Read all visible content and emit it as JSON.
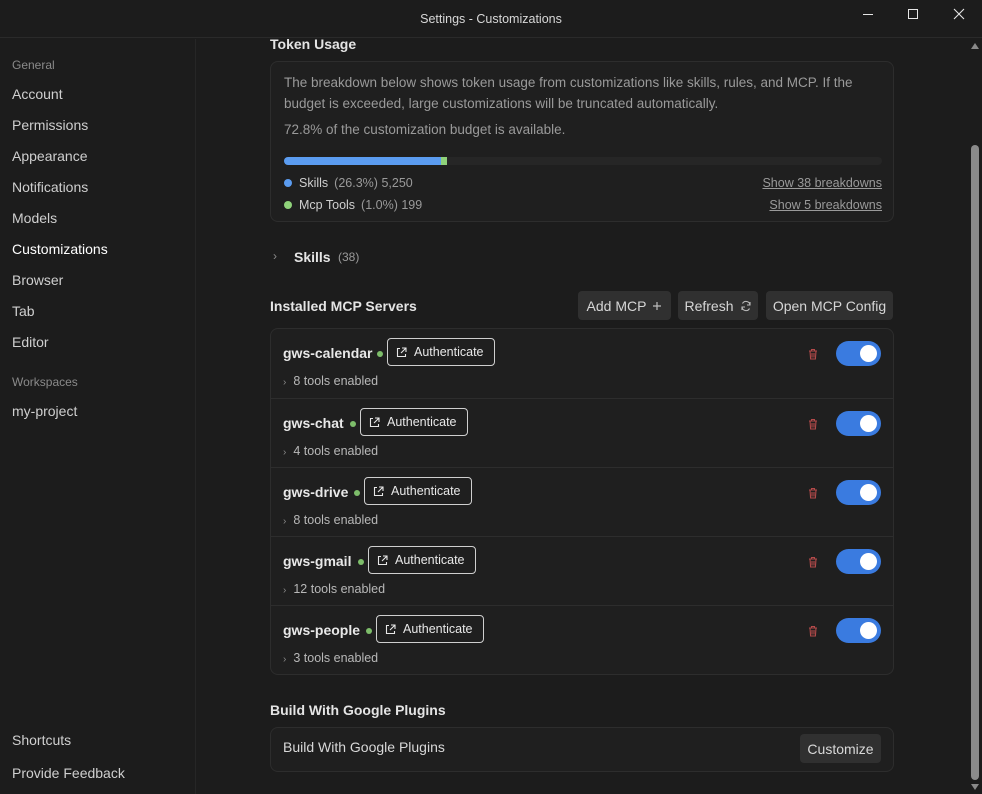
{
  "window": {
    "title": "Settings - Customizations",
    "minimize_icon": "minimize-icon",
    "maximize_icon": "maximize-icon",
    "close_icon": "close-icon"
  },
  "sidebar": {
    "general_heading": "General",
    "items": [
      {
        "label": "Account"
      },
      {
        "label": "Permissions"
      },
      {
        "label": "Appearance"
      },
      {
        "label": "Notifications"
      },
      {
        "label": "Models"
      },
      {
        "label": "Customizations",
        "active": true
      },
      {
        "label": "Browser"
      },
      {
        "label": "Tab"
      },
      {
        "label": "Editor"
      }
    ],
    "workspaces_heading": "Workspaces",
    "workspaces": [
      {
        "label": "my-project"
      }
    ],
    "footer": [
      {
        "label": "Shortcuts"
      },
      {
        "label": "Provide Feedback"
      }
    ]
  },
  "token_usage": {
    "title": "Token Usage",
    "description": "The breakdown below shows token usage from customizations like skills, rules, and MCP. If the budget is exceeded, large customizations will be truncated automatically.",
    "available_text": "72.8% of the customization budget is available.",
    "breakdown": [
      {
        "name": "Skills",
        "percent_label": "(26.3%)",
        "tokens": "5,250",
        "percent": 26.3,
        "color": "#5b9cf0",
        "link": "Show 38 breakdowns"
      },
      {
        "name": "Mcp Tools",
        "percent_label": "(1.0%)",
        "tokens": "199",
        "percent": 1.0,
        "color": "#8fd27a",
        "link": "Show 5 breakdowns"
      }
    ]
  },
  "skills_section": {
    "label": "Skills",
    "count": "(38)"
  },
  "mcp": {
    "title": "Installed MCP Servers",
    "add_label": "Add MCP",
    "refresh_label": "Refresh",
    "open_config_label": "Open MCP Config",
    "auth_label": "Authenticate",
    "status_color": "#7dbd6a",
    "servers": [
      {
        "name": "gws-calendar",
        "tools": "8 tools enabled",
        "enabled": true
      },
      {
        "name": "gws-chat",
        "tools": "4 tools enabled",
        "enabled": true
      },
      {
        "name": "gws-drive",
        "tools": "8 tools enabled",
        "enabled": true
      },
      {
        "name": "gws-gmail",
        "tools": "12 tools enabled",
        "enabled": true
      },
      {
        "name": "gws-people",
        "tools": "3 tools enabled",
        "enabled": true
      }
    ]
  },
  "plugins": {
    "title": "Build With Google Plugins",
    "item_name": "Build With Google Plugins",
    "customize_label": "Customize"
  }
}
